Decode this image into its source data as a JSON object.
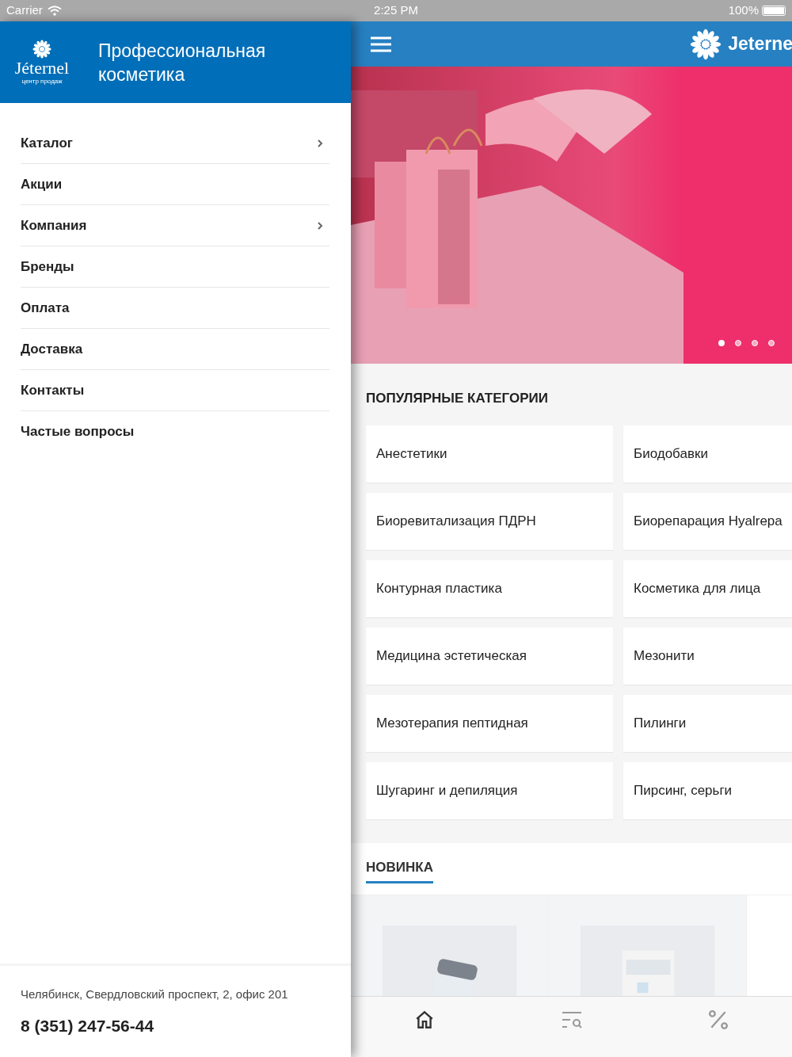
{
  "status_bar": {
    "carrier": "Carrier",
    "time": "2:25 PM",
    "battery": "100%"
  },
  "drawer": {
    "logo": {
      "name": "Jéternel",
      "tagline": "центр продаж"
    },
    "title": "Профессиональная косметика",
    "menu": [
      {
        "label": "Каталог",
        "has_children": true
      },
      {
        "label": "Акции",
        "has_children": false
      },
      {
        "label": "Компания",
        "has_children": true
      },
      {
        "label": "Бренды",
        "has_children": false
      },
      {
        "label": "Оплата",
        "has_children": false
      },
      {
        "label": "Доставка",
        "has_children": false
      },
      {
        "label": "Контакты",
        "has_children": false
      },
      {
        "label": "Частые вопросы",
        "has_children": false
      }
    ],
    "address": "Челябинск, Свердловский проспект, 2, офис 201",
    "phone": "8 (351) 247-56-44"
  },
  "header": {
    "brand": "Jeterne"
  },
  "banner": {
    "kind": "picture",
    "dots": [
      {
        "selected": true
      },
      {
        "selected": false
      },
      {
        "selected": false
      },
      {
        "selected": false
      }
    ]
  },
  "popular": {
    "title": "ПОПУЛЯРНЫЕ КАТЕГОРИИ",
    "categories": [
      "Анестетики",
      "Биодобавки",
      "Биоревитализация ПДРН",
      "Биорепарация Hyalrepa",
      "Контурная пластика",
      "Косметика для лица",
      "Медицина эстетическая",
      "Мезонити",
      "Мезотерапия пептидная",
      "Пилинги",
      "Шугаринг и депиляция",
      "Пирсинг, серьги"
    ]
  },
  "new_tabs": [
    {
      "label": "НОВИНКА",
      "selected": true
    }
  ],
  "tab_bar": [
    {
      "kind": "home",
      "selected": true
    },
    {
      "kind": "catalog",
      "selected": false
    },
    {
      "kind": "sale",
      "selected": false
    }
  ]
}
